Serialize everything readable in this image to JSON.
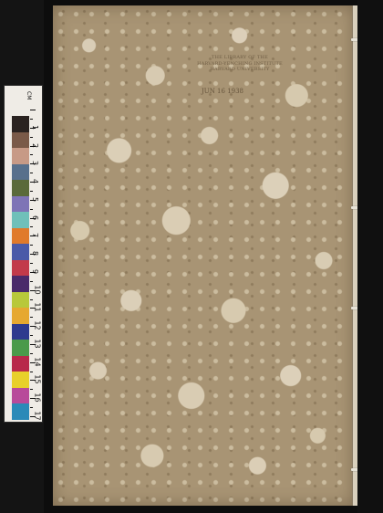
{
  "cover": {
    "stamp_lines": [
      "THE LIBRARY OF THE",
      "HARVARD-YENCHING INSTITUTE",
      "HARVARD UNIVERSITY"
    ],
    "stamp_date": "JUN 16 1938",
    "handwritten_top": "",
    "handwritten_right": "",
    "colors": {
      "paper": "#a89474",
      "spots": "#d9cdb6",
      "ink_red": "#a25c46"
    }
  },
  "color_target": {
    "ruler_unit": "CM",
    "ruler_numbers": [
      "1",
      "2",
      "3",
      "4",
      "5",
      "6",
      "7",
      "8",
      "9",
      "10",
      "11",
      "12",
      "13",
      "14",
      "15",
      "16",
      "17"
    ],
    "swatches": [
      {
        "name": "",
        "color": "#2a2320"
      },
      {
        "name": "",
        "color": "#7a5a48"
      },
      {
        "name": "",
        "color": "#c79a86"
      },
      {
        "name": "",
        "color": "#58708c"
      },
      {
        "name": "",
        "color": "#5a6a3a"
      },
      {
        "name": "",
        "color": "#7e74b6"
      },
      {
        "name": "",
        "color": "#6fc0b9"
      },
      {
        "name": "",
        "color": "#e07a2a"
      },
      {
        "name": "",
        "color": "#4a5aa8"
      },
      {
        "name": "",
        "color": "#c23a4a"
      },
      {
        "name": "",
        "color": "#4a2a6a"
      },
      {
        "name": "",
        "color": "#b8c83a"
      },
      {
        "name": "",
        "color": "#e6a830"
      },
      {
        "name": "",
        "color": "#2e3a8e"
      },
      {
        "name": "",
        "color": "#4a9a4a"
      },
      {
        "name": "",
        "color": "#b8284a"
      },
      {
        "name": "",
        "color": "#e8d02a"
      },
      {
        "name": "",
        "color": "#b84a9a"
      },
      {
        "name": "",
        "color": "#2a8ab8"
      }
    ]
  }
}
